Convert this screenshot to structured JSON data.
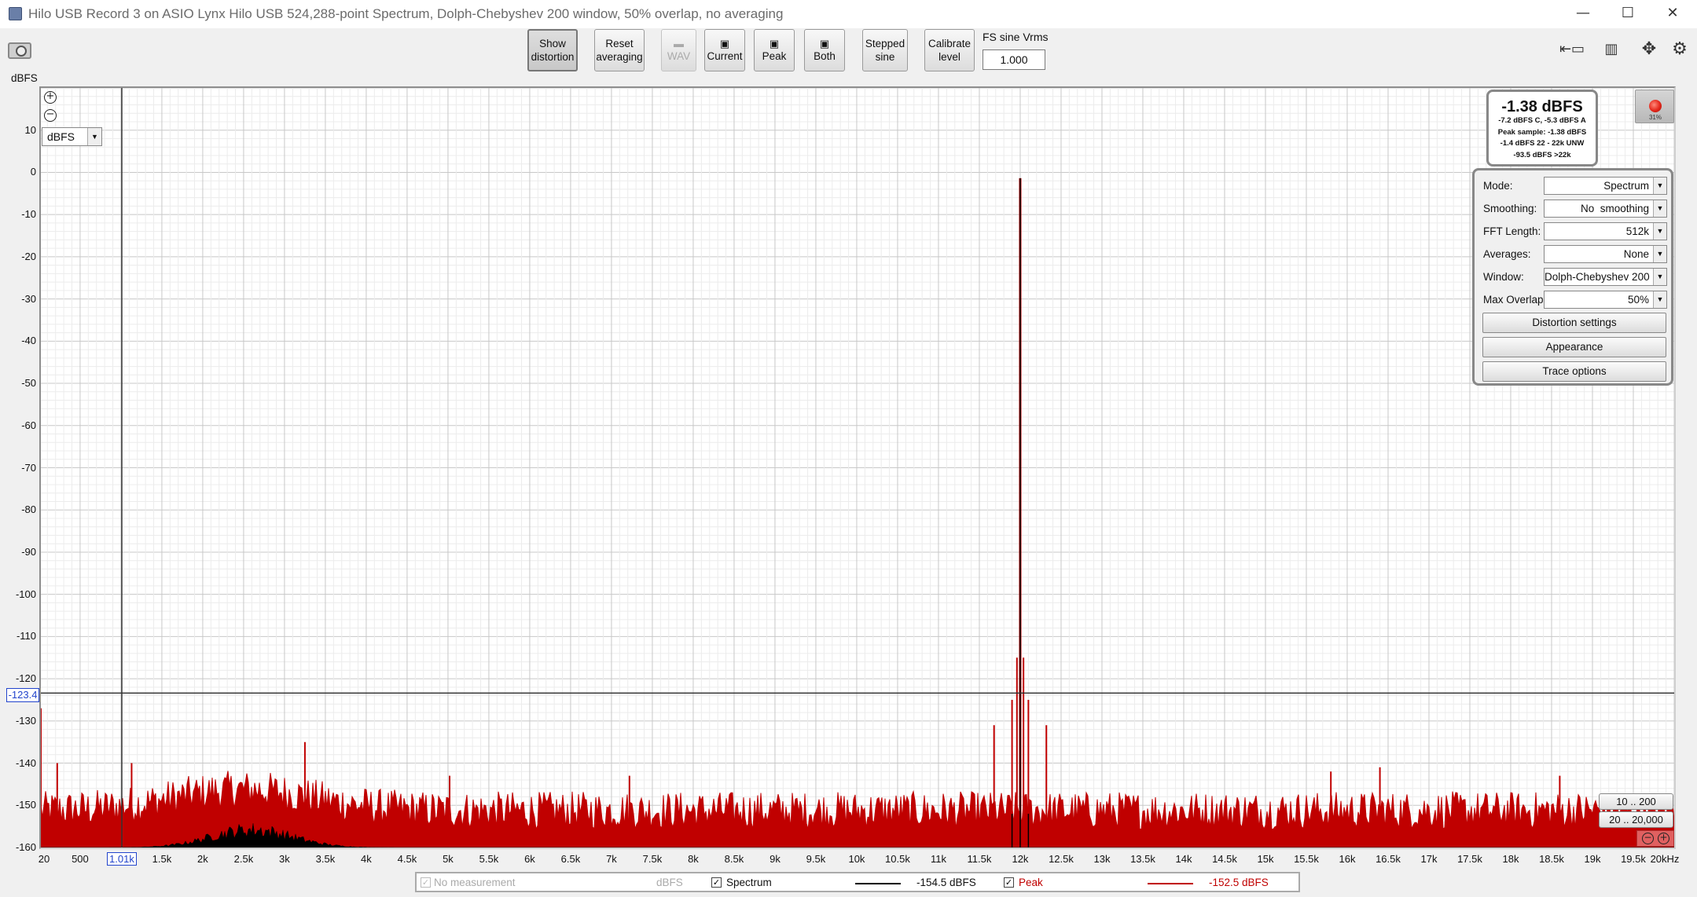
{
  "window": {
    "title": "Hilo USB Record 3 on ASIO Lynx Hilo USB 524,288-point Spectrum, Dolph-Chebyshev 200 window, 50% overlap, no averaging",
    "min_glyph": "—",
    "max_glyph": "☐",
    "close_glyph": "✕"
  },
  "toolbar": {
    "show_distortion": [
      "Show",
      "distortion"
    ],
    "reset_averaging": [
      "Reset",
      "averaging"
    ],
    "wav_label": "WAV",
    "current_label": "Current",
    "peak_label": "Peak",
    "both_label": "Both",
    "stepped_sine": [
      "Stepped",
      "sine"
    ],
    "calibrate_level": [
      "Calibrate",
      "level"
    ],
    "fs_sine_label": "FS sine Vrms",
    "fs_sine_value": "1.000"
  },
  "plot": {
    "y_unit": "dBFS",
    "unit_selector": "dBFS",
    "y_cursor_value": "-123.4",
    "x_cursor_value": "1.01k",
    "y_ticks": [
      "10",
      "0",
      "-10",
      "-20",
      "-30",
      "-40",
      "-50",
      "-60",
      "-70",
      "-80",
      "-90",
      "-100",
      "-110",
      "-120",
      "-130",
      "-140",
      "-150",
      "-160"
    ],
    "x_ticks": [
      "20",
      "500",
      "1.01k",
      "1.5k",
      "2k",
      "2.5k",
      "3k",
      "3.5k",
      "4k",
      "4.5k",
      "5k",
      "5.5k",
      "6k",
      "6.5k",
      "7k",
      "7.5k",
      "8k",
      "8.5k",
      "9k",
      "9.5k",
      "10k",
      "10.5k",
      "11k",
      "11.5k",
      "12k",
      "12.5k",
      "13k",
      "13.5k",
      "14k",
      "14.5k",
      "15k",
      "15.5k",
      "16k",
      "16.5k",
      "17k",
      "17.5k",
      "18k",
      "18.5k",
      "19k",
      "19.5k",
      "20kHz"
    ]
  },
  "readout": {
    "level": "-1.38 dBFS",
    "lines": [
      "-7.2 dBFS C, -5.3 dBFS A",
      "Peak sample: -1.38 dBFS",
      "-1.4 dBFS 22 - 22k UNW",
      "-93.5 dBFS >22k"
    ],
    "record_pct": "31%"
  },
  "settings": {
    "mode_label": "Mode:",
    "mode_value": "Spectrum",
    "smoothing_label": "Smoothing:",
    "smoothing_value": "No  smoothing",
    "fft_label": "FFT Length:",
    "fft_value": "512k",
    "averages_label": "Averages:",
    "averages_value": "None",
    "window_label": "Window:",
    "window_value": "Dolph-Chebyshev 200",
    "overlap_label": "Max Overlap:",
    "overlap_value": "50%",
    "distortion_settings": "Distortion settings",
    "appearance": "Appearance",
    "trace_options": "Trace options"
  },
  "ranges": {
    "range1": "10 .. 200",
    "range2": "20 .. 20,000"
  },
  "legend": {
    "no_measurement": "No measurement",
    "no_measurement_unit": "dBFS",
    "spectrum_label": "Spectrum",
    "spectrum_value": "-154.5 dBFS",
    "peak_label": "Peak",
    "peak_value": "-152.5 dBFS",
    "check_glyph": "✓"
  },
  "chart_data": {
    "type": "line",
    "x_unit": "Hz",
    "y_unit": "dBFS",
    "xlim": [
      20,
      20000
    ],
    "ylim": [
      -160,
      20
    ],
    "cursor": {
      "x": 1010,
      "y": -123.4
    },
    "series": [
      {
        "name": "Spectrum",
        "color": "#000000",
        "noise_floor_dbfs": -160,
        "hump": {
          "center_hz": 2600,
          "width_hz": 700,
          "peak_dbfs": -157
        },
        "peaks": [
          {
            "x": 12000,
            "y": -1.38
          },
          {
            "x": 11900,
            "y": -152
          },
          {
            "x": 12100,
            "y": -152
          }
        ]
      },
      {
        "name": "Peak",
        "color": "#c00000",
        "noise_floor_dbfs": -153,
        "hump": {
          "center_hz": 2500,
          "width_hz": 1200,
          "peak_dbfs": -148
        },
        "peaks": [
          {
            "x": 20,
            "y": -127
          },
          {
            "x": 220,
            "y": -140
          },
          {
            "x": 1130,
            "y": -140
          },
          {
            "x": 3250,
            "y": -135
          },
          {
            "x": 5020,
            "y": -143
          },
          {
            "x": 7220,
            "y": -143
          },
          {
            "x": 11680,
            "y": -131
          },
          {
            "x": 11900,
            "y": -125
          },
          {
            "x": 11960,
            "y": -115
          },
          {
            "x": 12000,
            "y": -1.38
          },
          {
            "x": 12040,
            "y": -115
          },
          {
            "x": 12100,
            "y": -125
          },
          {
            "x": 12320,
            "y": -131
          },
          {
            "x": 15800,
            "y": -142
          },
          {
            "x": 16400,
            "y": -141
          },
          {
            "x": 18600,
            "y": -143
          }
        ]
      }
    ]
  },
  "colors": {
    "peak_trace": "#c00000",
    "spectrum_trace": "#000000",
    "cursor_line": "#333333",
    "grid": "#d6d6d6",
    "cursor_label": "#2244cc"
  }
}
